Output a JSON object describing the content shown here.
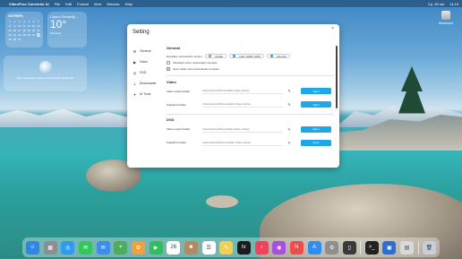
{
  "menubar": {
    "apple": "",
    "app_name": "VideoProc Converter AI",
    "items": [
      "File",
      "Edit",
      "Format",
      "View",
      "Window",
      "Help"
    ],
    "date": "Ср, 28 окт.",
    "time": "11:15"
  },
  "calendar_widget": {
    "month": "ОКТЯБРЬ",
    "days": [
      "1",
      "2",
      "3",
      "4",
      "5",
      "6",
      "7",
      "8",
      "9",
      "10",
      "11",
      "12",
      "13",
      "14",
      "15",
      "16",
      "17",
      "18",
      "19",
      "20",
      "21",
      "22",
      "23",
      "24",
      "25",
      "26",
      "27",
      "28",
      "29",
      "30",
      "31"
    ],
    "today": "28"
  },
  "weather_widget": {
    "city": "Санкт-Петербу...",
    "temp": "10°",
    "condition": "Облачно"
  },
  "ai_widget": {
    "text": "Ваш помощник здесь по вопросам обработки"
  },
  "desktop_icon": {
    "label": "Macintosh"
  },
  "window": {
    "title": "Setting",
    "close": "×",
    "sidebar": [
      {
        "icon": "gear-icon",
        "label": "General"
      },
      {
        "icon": "video-icon",
        "label": "Video"
      },
      {
        "icon": "dvd-icon",
        "label": "DVD"
      },
      {
        "icon": "download-icon",
        "label": "Downloader"
      },
      {
        "icon": "ai-icon",
        "label": "AI Tools"
      }
    ],
    "general": {
      "title": "General",
      "hw_label": "Hardware acceleration engine",
      "hw_options": [
        "Nvidia",
        "Intel / AMD / MAX",
        "Remind"
      ],
      "shutdown_label": "Shutdown when downloads complete",
      "open_folder_label": "Open folder when downloads complete"
    },
    "video": {
      "title": "Video",
      "rows": [
        {
          "label": "Video output Folder",
          "path": "/Users/admin/Movies/Mac Video Library",
          "button": "Open"
        },
        {
          "label": "Snapshot Folder",
          "path": "/Users/admin/Pictures/Mac Video Library",
          "button": "Open"
        }
      ]
    },
    "dvd": {
      "title": "DVD",
      "rows": [
        {
          "label": "Video output Folder",
          "path": "/Users/admin/Movies/Mac Video Library",
          "button": "Open"
        },
        {
          "label": "Snapshot Folder",
          "path": "/Users/admin/Pictures/Mac Video Library",
          "button": "Open"
        }
      ]
    }
  },
  "dock": {
    "apps": [
      {
        "name": "finder-icon",
        "color": "#2f86e6",
        "glyph": "☺"
      },
      {
        "name": "launchpad-icon",
        "color": "#8d8d95",
        "glyph": "▦"
      },
      {
        "name": "safari-icon",
        "color": "#2d9cf0",
        "glyph": "◎"
      },
      {
        "name": "messages-icon",
        "color": "#34c759",
        "glyph": "✉"
      },
      {
        "name": "mail-icon",
        "color": "#3c8ee8",
        "glyph": "✉"
      },
      {
        "name": "maps-icon",
        "color": "#4cae5a",
        "glyph": "⌖"
      },
      {
        "name": "photos-icon",
        "color": "#f2a03b",
        "glyph": "✿"
      },
      {
        "name": "facetime-icon",
        "color": "#2fbf5a",
        "glyph": "▶"
      },
      {
        "name": "calendar-icon",
        "color": "#ffffff",
        "glyph": "26"
      },
      {
        "name": "contacts-icon",
        "color": "#b48a5e",
        "glyph": "☻"
      },
      {
        "name": "reminders-icon",
        "color": "#ffffff",
        "glyph": "☰"
      },
      {
        "name": "notes-icon",
        "color": "#f4d04e",
        "glyph": "✎"
      },
      {
        "name": "tv-icon",
        "color": "#1c1c1e",
        "glyph": "tv"
      },
      {
        "name": "music-icon",
        "color": "#f5405a",
        "glyph": "♪"
      },
      {
        "name": "podcasts-icon",
        "color": "#a94fe0",
        "glyph": "◉"
      },
      {
        "name": "news-icon",
        "color": "#f24b4b",
        "glyph": "N"
      },
      {
        "name": "appstore-icon",
        "color": "#2e8ef0",
        "glyph": "A"
      },
      {
        "name": "settings-icon",
        "color": "#8e8e93",
        "glyph": "⚙"
      },
      {
        "name": "iphone-mirroring-icon",
        "color": "#3a3a3c",
        "glyph": "▯"
      },
      {
        "name": "terminal-icon",
        "color": "#222222",
        "glyph": ">_"
      },
      {
        "name": "videoproc-icon",
        "color": "#2b6fd6",
        "glyph": "▣"
      },
      {
        "name": "preview-icon",
        "color": "#d9d9d9",
        "glyph": "▤"
      },
      {
        "name": "trash-icon",
        "color": "#c9ced4",
        "glyph": "🗑"
      }
    ]
  }
}
